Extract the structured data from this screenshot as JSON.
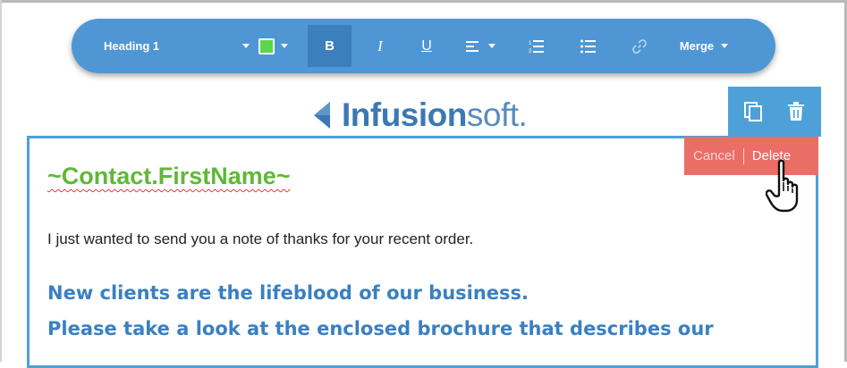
{
  "toolbar": {
    "heading_label": "Heading 1",
    "text_color": "#5cd64b",
    "bold_label": "B",
    "italic_label": "I",
    "underline_label": "U",
    "merge_label": "Merge",
    "active_button": "bold"
  },
  "logo": {
    "bold_part": "Infusion",
    "light_part": "soft."
  },
  "block_actions": {
    "icons": [
      "copy-icon",
      "trash-icon"
    ]
  },
  "delete_confirm": {
    "cancel_label": "Cancel",
    "delete_label": "Delete"
  },
  "content": {
    "merge_field": "~Contact.FirstName~",
    "intro": "I just wanted to send you a note of thanks for your recent order.",
    "promo_line1": "New clients are the lifeblood of our business.",
    "promo_line2": "Please take a look at the enclosed brochure that describes our"
  },
  "colors": {
    "toolbar_bg": "#4f97d4",
    "active_button_bg": "#3b7fbd",
    "block_border": "#4da1d8",
    "delete_bar_bg": "#ea6e66",
    "merge_field_text": "#60b838",
    "promo_text": "#3a80c1"
  }
}
